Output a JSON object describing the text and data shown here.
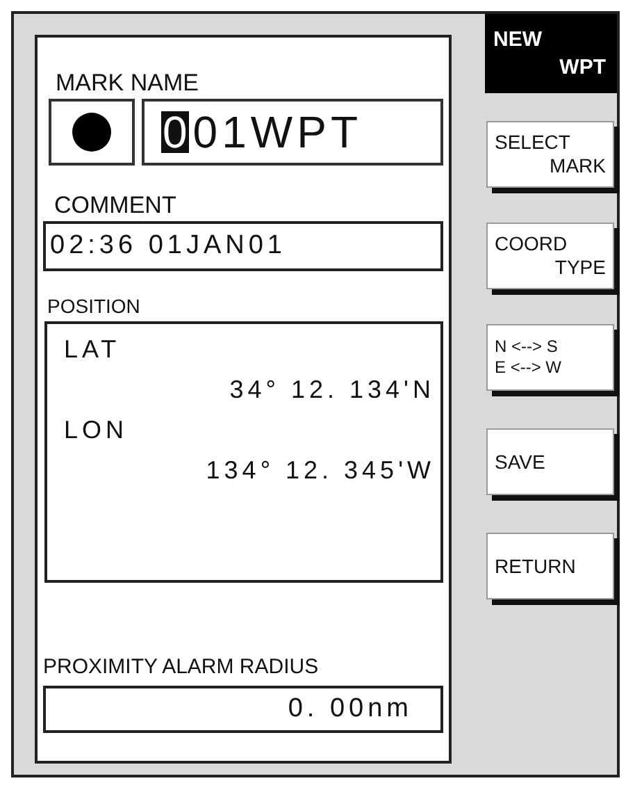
{
  "header": {
    "lines": [
      "NEW",
      "WPT"
    ]
  },
  "mark_name": {
    "label": "MARK NAME",
    "cursor_char": "0",
    "rest": "01WPT"
  },
  "comment": {
    "label": "COMMENT",
    "value": "02:36 01JAN01"
  },
  "position": {
    "label": "POSITION",
    "entries": [
      {
        "label": "LAT",
        "value": "34° 12. 134'N"
      },
      {
        "label": "LON",
        "value": "134° 12. 345'W"
      }
    ]
  },
  "proximity_alarm": {
    "label": "PROXIMITY ALARM RADIUS",
    "value": "0. 00nm"
  },
  "buttons": [
    {
      "kind": "split",
      "lines": [
        "SELECT",
        "MARK"
      ]
    },
    {
      "kind": "split",
      "lines": [
        "COORD",
        "TYPE"
      ]
    },
    {
      "kind": "stacked",
      "lines": [
        "N <--> S",
        "E <--> W"
      ]
    },
    {
      "kind": "single",
      "lines": [
        "SAVE"
      ]
    },
    {
      "kind": "single",
      "lines": [
        "RETURN"
      ]
    }
  ]
}
